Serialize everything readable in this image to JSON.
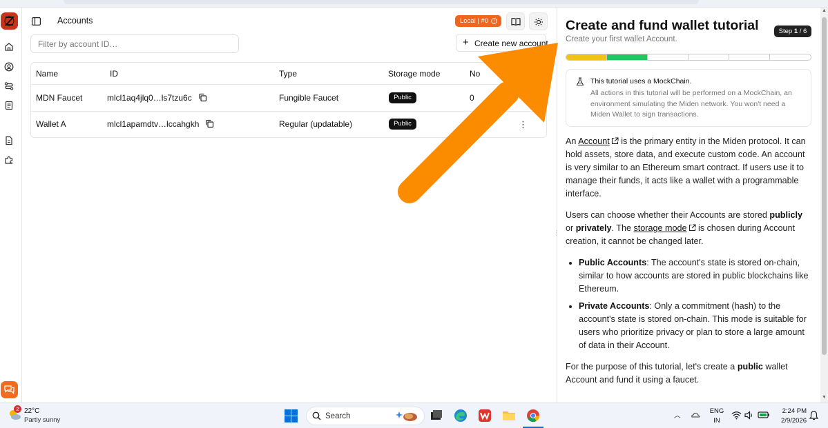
{
  "app": {
    "title": "Accounts"
  },
  "header": {
    "network_badge": "Local | #0",
    "create_button": "Create new account"
  },
  "filter": {
    "placeholder": "Filter by account ID…"
  },
  "table": {
    "columns": [
      "Name",
      "ID",
      "Type",
      "Storage mode",
      "No"
    ],
    "rows": [
      {
        "name": "MDN Faucet",
        "id": "mlcl1aq4jlq0…ls7tzu6c",
        "type": "Fungible Faucet",
        "storage": "Public",
        "nonce": "0"
      },
      {
        "name": "Wallet A",
        "id": "mlcl1apamdtv…lccahgkh",
        "type": "Regular (updatable)",
        "storage": "Public",
        "nonce": ""
      }
    ]
  },
  "tutorial": {
    "title": "Create and fund wallet tutorial",
    "subtitle": "Create your first wallet Account.",
    "step_prefix": "Step ",
    "step_current": "1",
    "step_sep": " / ",
    "step_total": "6",
    "progress_segments": 6,
    "progress_current": 1,
    "notice_title": "This tutorial uses a MockChain.",
    "notice_body": "All actions in this tutorial will be performed on a MockChain, an environment simulating the Miden network. You won't need a Miden Wallet to sign transactions.",
    "p1_a": "An ",
    "p1_link": "Account",
    "p1_b": " is the primary entity in the Miden protocol. It can hold assets, store data, and execute custom code. An account is very similar to an Ethereum smart contract. If users use it to manage their funds, it acts like a wallet with a programmable interface.",
    "p2_a": "Users can choose whether their Accounts are stored ",
    "p2_b1": "publicly",
    "p2_c": " or ",
    "p2_b2": "privately",
    "p2_d": ". The ",
    "p2_link": "storage mode",
    "p2_e": " is chosen during Account creation, it cannot be changed later.",
    "li1_b": "Public Accounts",
    "li1_t": ": The account's state is stored on-chain, similar to how accounts are stored in public blockchains like Ethereum.",
    "li2_b": "Private Accounts",
    "li2_t": ": Only a commitment (hash) to the account's state is stored on-chain. This mode is suitable for users who prioritize privacy or plan to store a large amount of data in their Account.",
    "p3_a": "For the purpose of this tutorial, let's create a ",
    "p3_b": "public",
    "p3_c": " wallet Account and fund it using a faucet."
  },
  "taskbar": {
    "weather_temp": "22°C",
    "weather_desc": "Partly sunny",
    "weather_badge": "2",
    "search_label": "Search",
    "lang_1": "ENG",
    "lang_2": "IN",
    "time": "2:24 PM",
    "date": "2/9/2026"
  },
  "colors": {
    "accent_orange": "#f2651c",
    "progress_yellow": "#f2c11a",
    "progress_green": "#22c55e",
    "arrow_orange": "#fb8c00"
  }
}
